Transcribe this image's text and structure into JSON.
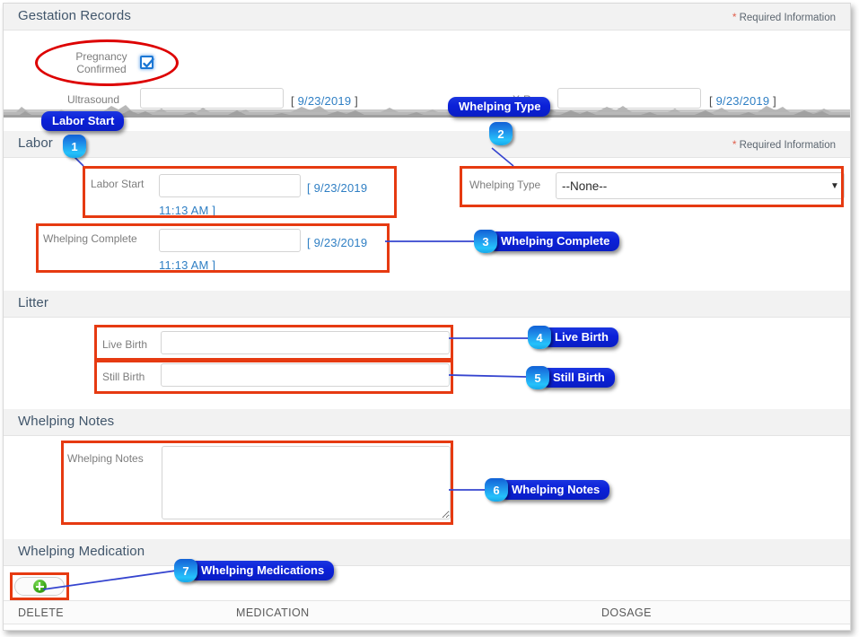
{
  "meta": {
    "required_note": "Required Information",
    "required_star": "*",
    "accent_red_box": "#e63a11",
    "accent_red_ellipse": "#dd0000",
    "accent_blue_pill": "#0b20d8",
    "accent_cyan_badge": "#25c1fb",
    "section_header_bg": "#f2f2f2",
    "section_title_color": "#41566b",
    "date_hint_color": "#2f7fc4"
  },
  "sections": {
    "gestation": {
      "title": "Gestation Records",
      "pregnancy_label_line1": "Pregnancy",
      "pregnancy_label_line2": "Confirmed",
      "pregnancy_checked": true,
      "ultrasound_label": "Ultrasound",
      "ultrasound_value": "",
      "ultrasound_hint_open": "[",
      "ultrasound_hint_date": "9/23/2019",
      "ultrasound_hint_close": "]",
      "xray_label": "X-Ray",
      "xray_value": "",
      "xray_hint_open": "[",
      "xray_hint_date": "9/23/2019",
      "xray_hint_close": "]"
    },
    "labor": {
      "title": "Labor",
      "labor_start_label": "Labor Start",
      "labor_start_value": "",
      "labor_start_hint_line1": "[ 9/23/2019",
      "labor_start_hint_line2": "11:13 AM ]",
      "whelping_complete_label": "Whelping Complete",
      "whelping_complete_value": "",
      "whelping_complete_hint_line1": "[ 9/23/2019",
      "whelping_complete_hint_line2": "11:13 AM ]",
      "whelping_type_label": "Whelping Type",
      "whelping_type_value": "--None--",
      "whelping_type_options": [
        "--None--"
      ],
      "whelping_type_caret": "▼"
    },
    "litter": {
      "title": "Litter",
      "live_birth_label": "Live Birth",
      "live_birth_value": "",
      "still_birth_label": "Still Birth",
      "still_birth_value": ""
    },
    "whelping_notes": {
      "title": "Whelping Notes",
      "field_label": "Whelping Notes",
      "field_value": ""
    },
    "whelping_medication": {
      "title": "Whelping Medication",
      "add_button_icon": "plus-circle-icon",
      "columns": [
        "DELETE",
        "MEDICATION",
        "DOSAGE"
      ],
      "rows": []
    }
  },
  "callouts": [
    {
      "number": "1",
      "label": "Labor Start"
    },
    {
      "number": "2",
      "label": "Whelping Type"
    },
    {
      "number": "3",
      "label": "Whelping Complete"
    },
    {
      "number": "4",
      "label": "Live Birth"
    },
    {
      "number": "5",
      "label": "Still Birth"
    },
    {
      "number": "6",
      "label": "Whelping Notes"
    },
    {
      "number": "7",
      "label": "Whelping Medications"
    }
  ]
}
